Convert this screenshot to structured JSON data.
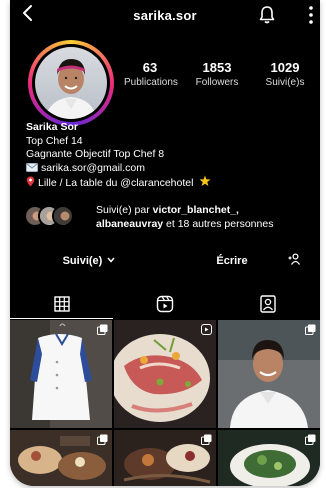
{
  "header": {
    "username": "sarika.sor"
  },
  "stats": [
    {
      "value": "63",
      "label": "Publications"
    },
    {
      "value": "1853",
      "label": "Followers"
    },
    {
      "value": "1029",
      "label": "Suivi(e)s"
    }
  ],
  "bio": {
    "name": "Sarika Sor",
    "line1": "Top Chef 14",
    "line2": "Gagnante Objectif Top Chef 8",
    "email": "sarika.sor@gmail.com",
    "location": "Lille / La table du @clarancehotel",
    "icons": [
      "envelope-icon",
      "pin-icon",
      "star-icon"
    ]
  },
  "followed_by": {
    "prefix": "Suivi(e) par ",
    "user": "victor_blanchet_,",
    "line2_user": "albaneauvray",
    "line2_suffix": " et 18 autres personnes"
  },
  "actions": {
    "follow_label": "Suivi(e)",
    "write_label": "Écrire"
  },
  "tabs": [
    {
      "name": "grid-icon",
      "active": true
    },
    {
      "name": "reels-icon",
      "active": false
    },
    {
      "name": "tagged-icon",
      "active": false
    }
  ],
  "colors": {
    "background": "#000000",
    "text": "#ffffff",
    "ring": [
      "#f9ce34",
      "#ee2a7b",
      "#6228d7"
    ]
  }
}
